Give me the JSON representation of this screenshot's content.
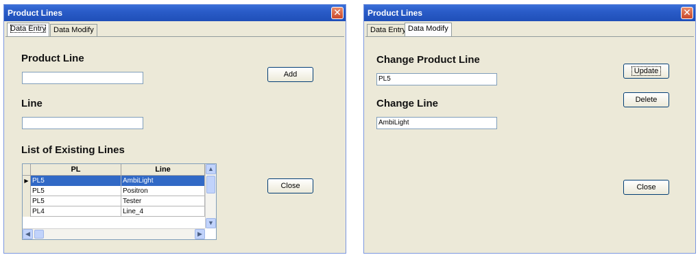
{
  "colors": {
    "title_bar": "#2a5cc8",
    "selection": "#3169c6",
    "dialog_bg": "#ece9d8",
    "close_button": "#c9482a"
  },
  "left_window": {
    "title": "Product Lines",
    "tabs": [
      {
        "label": "Data Entry",
        "active": true
      },
      {
        "label": "Data Modify",
        "active": false
      }
    ],
    "product_line_label": "Product Line",
    "product_line_value": "",
    "line_label": "Line",
    "line_value": "",
    "list_label": "List of Existing Lines",
    "add_label": "Add",
    "close_label": "Close",
    "grid": {
      "columns": [
        "PL",
        "Line"
      ],
      "rows": [
        {
          "pl": "PL5",
          "line": "AmbiLight",
          "selected": true
        },
        {
          "pl": "PL5",
          "line": "Positron",
          "selected": false
        },
        {
          "pl": "PL5",
          "line": "Tester",
          "selected": false
        },
        {
          "pl": "PL4",
          "line": "Line_4",
          "selected": false
        }
      ],
      "current_row_marker": "▶"
    }
  },
  "right_window": {
    "title": "Product Lines",
    "tabs": [
      {
        "label": "Data Entry",
        "active": false
      },
      {
        "label": "Data Modify",
        "active": true
      }
    ],
    "change_product_line_label": "Change Product Line",
    "change_product_line_value": "PL5",
    "change_line_label": "Change Line",
    "change_line_value": "AmbiLight",
    "update_label": "Update",
    "delete_label": "Delete",
    "close_label": "Close"
  },
  "icons": {
    "close": "close-icon",
    "scroll_up": "chevron-up-icon",
    "scroll_down": "chevron-down-icon",
    "scroll_left": "chevron-left-icon",
    "scroll_right": "chevron-right-icon"
  }
}
